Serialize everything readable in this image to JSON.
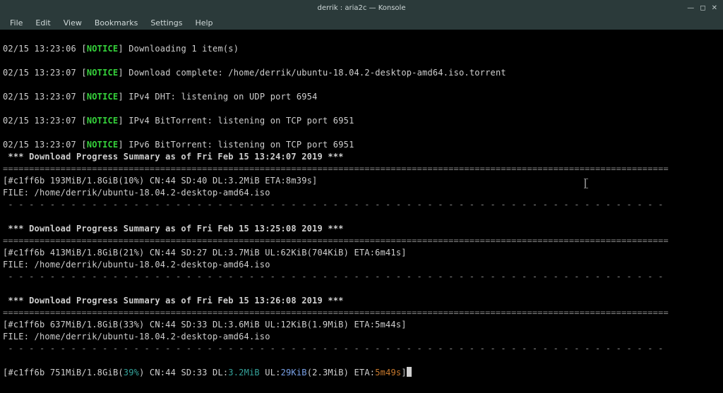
{
  "window": {
    "title": "derrik : aria2c — Konsole"
  },
  "menu": {
    "file": "File",
    "edit": "Edit",
    "view": "View",
    "bookmarks": "Bookmarks",
    "settings": "Settings",
    "help": "Help"
  },
  "lines": {
    "l0": {
      "ts": "02/15 13:23:06 ",
      "notice": "NOTICE",
      "msg": " Downloading 1 item(s)"
    },
    "l1": {
      "ts": "02/15 13:23:07 ",
      "notice": "NOTICE",
      "msg": " Download complete: /home/derrik/ubuntu-18.04.2-desktop-amd64.iso.torrent"
    },
    "l2": {
      "ts": "02/15 13:23:07 ",
      "notice": "NOTICE",
      "msg": " IPv4 DHT: listening on UDP port 6954"
    },
    "l3": {
      "ts": "02/15 13:23:07 ",
      "notice": "NOTICE",
      "msg": " IPv4 BitTorrent: listening on TCP port 6951"
    },
    "l4": {
      "ts": "02/15 13:23:07 ",
      "notice": "NOTICE",
      "msg": " IPv6 BitTorrent: listening on TCP port 6951"
    },
    "s1": " *** Download Progress Summary as of Fri Feb 15 13:24:07 2019 *** ",
    "eq": "===============================================================================================================================",
    "dash": " - - - - - - - - - - - - - - - - - - - - - - - - - - - - - - - - - - - - - - - - - - - - - - - - - - - - - - - - - - - - - - -",
    "d1a": "[#c1ff6b 193MiB/1.8GiB(10%) CN:44 SD:40 DL:3.2MiB ETA:8m39s]",
    "d1b": "FILE: /home/derrik/ubuntu-18.04.2-desktop-amd64.iso",
    "s2": " *** Download Progress Summary as of Fri Feb 15 13:25:08 2019 *** ",
    "d2a": "[#c1ff6b 413MiB/1.8GiB(21%) CN:44 SD:27 DL:3.7MiB UL:62KiB(704KiB) ETA:6m41s]",
    "d2b": "FILE: /home/derrik/ubuntu-18.04.2-desktop-amd64.iso",
    "s3": " *** Download Progress Summary as of Fri Feb 15 13:26:08 2019 *** ",
    "d3a": "[#c1ff6b 637MiB/1.8GiB(33%) CN:44 SD:33 DL:3.6MiB UL:12KiB(1.9MiB) ETA:5m44s]",
    "d3b": "FILE: /home/derrik/ubuntu-18.04.2-desktop-amd64.iso",
    "live": {
      "open": "[",
      "hash": "#c1ff6b",
      "size": " 751MiB/1.8GiB(",
      "pct": "39%",
      "after_pct": ") CN:44 SD:33 DL:",
      "dl": "3.2MiB",
      "mid": " UL:",
      "ul": "29KiB",
      "ulacc": "(2.3MiB) ETA:",
      "eta": "5m49s",
      "close": "]"
    }
  }
}
